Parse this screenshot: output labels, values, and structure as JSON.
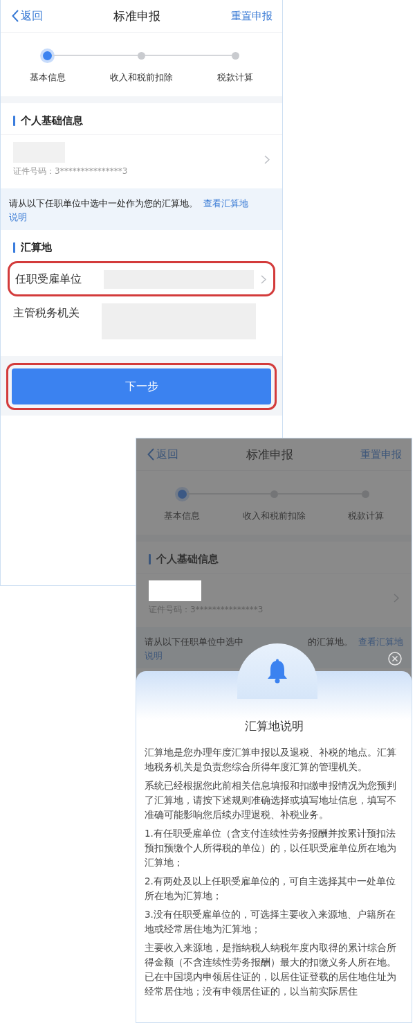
{
  "screen_main": {
    "dimmed": false,
    "nav": {
      "back": "返回",
      "title": "标准申报",
      "action": "重置申报"
    },
    "steps": [
      {
        "label": "基本信息",
        "current": true
      },
      {
        "label": "收入和税前扣除",
        "current": false
      },
      {
        "label": "税款计算",
        "current": false
      }
    ],
    "personal": {
      "heading": "个人基础信息",
      "id_line": "证件号码：3***************3"
    },
    "notice": {
      "text": "请从以下任职单位中选中一处作为您的汇算地。",
      "link_parts": [
        "查看汇算地",
        "说明"
      ]
    },
    "place": {
      "heading": "汇算地",
      "rows": [
        {
          "label": "任职受雇单位",
          "chevron": true,
          "highlighted": true
        },
        {
          "label": "主管税务机关",
          "chevron": false,
          "highlighted": false
        }
      ]
    },
    "next_button": {
      "label": "下一步",
      "highlighted": true
    }
  },
  "screen_popup": {
    "dimmed": true,
    "nav": {
      "back": "返回",
      "title": "标准申报",
      "action": "重置申报"
    },
    "steps": [
      {
        "label": "基本信息",
        "current": true
      },
      {
        "label": "收入和税前扣除",
        "current": false
      },
      {
        "label": "税款计算",
        "current": false
      }
    ],
    "personal": {
      "heading": "个人基础信息",
      "id_line": "证件号码：3***************3"
    },
    "notice": {
      "text_parts": [
        "请从以下任职单位中选中",
        "的汇算地。"
      ],
      "link_parts": [
        "查看汇算地",
        "说明"
      ]
    },
    "modal": {
      "title": "汇算地说明",
      "paragraphs": [
        "汇算地是您办理年度汇算申报以及退税、补税的地点。汇算地税务机关是负责您综合所得年度汇算的管理机关。",
        "系统已经根据您此前相关信息填报和扣缴申报情况为您预判了汇算地，请按下述规则准确选择或填写地址信息，填写不准确可能影响您后续办理退税、补税业务。",
        "1.有任职受雇单位（含支付连续性劳务报酬并按累计预扣法预扣预缴个人所得税的单位）的，以任职受雇单位所在地为汇算地；",
        "2.有两处及以上任职受雇单位的，可自主选择其中一处单位所在地为汇算地；",
        "3.没有任职受雇单位的，可选择主要收入来源地、户籍所在地或经常居住地为汇算地；",
        "主要收入来源地，是指纳税人纳税年度内取得的累计综合所得金额（不含连续性劳务报酬）最大的扣缴义务人所在地。已在中国境内申领居住证的，以居住证登载的居住地住址为经常居住地；没有申领居住证的，以当前实际居住"
      ]
    }
  }
}
